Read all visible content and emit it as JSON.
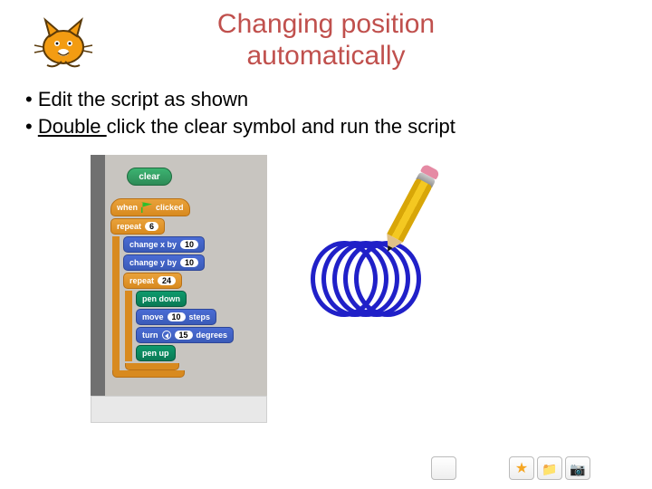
{
  "title_line1": "Changing position",
  "title_line2": "automatically",
  "bullets": [
    {
      "text_plain": "Edit the script as shown",
      "underline_word": ""
    },
    {
      "text_before": "",
      "underline_word": "Double ",
      "text_after": "click the clear symbol and run the script"
    }
  ],
  "scratch": {
    "clear": "clear",
    "when": "when",
    "clicked": "clicked",
    "repeat": "repeat",
    "repeat_outer_n": "6",
    "change_x": "change x by",
    "change_x_n": "10",
    "change_y": "change y by",
    "change_y_n": "10",
    "repeat_inner_n": "24",
    "pen_down": "pen down",
    "move": "move",
    "move_n": "10",
    "steps": "steps",
    "turn": "turn",
    "turn_n": "15",
    "degrees": "degrees",
    "pen_up": "pen up"
  },
  "toolbar": {
    "star": "★",
    "folder": "📁",
    "camera": "📷"
  }
}
